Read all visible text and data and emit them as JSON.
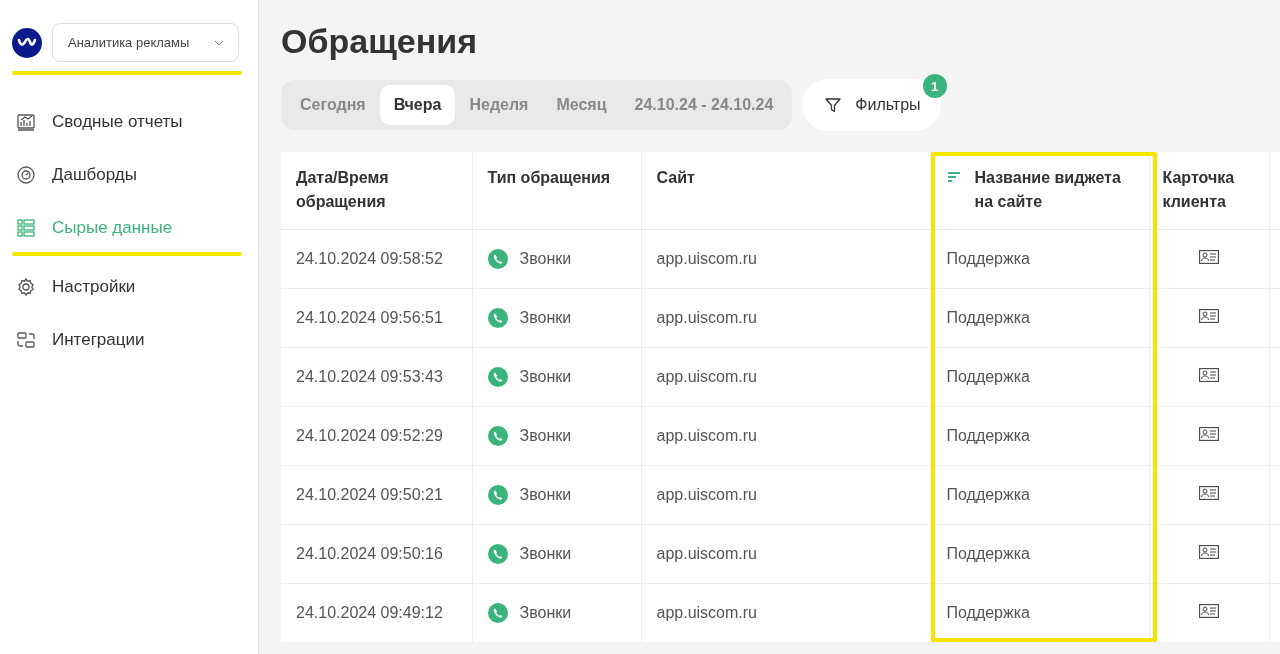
{
  "sidebar": {
    "project": "Аналитика рекламы",
    "items": [
      {
        "label": "Сводные отчеты",
        "selected": false
      },
      {
        "label": "Дашборды",
        "selected": false
      },
      {
        "label": "Сырые данные",
        "selected": true
      },
      {
        "label": "Настройки",
        "selected": false
      },
      {
        "label": "Интеграции",
        "selected": false
      }
    ]
  },
  "page_title": "Обращения",
  "period_tabs": [
    {
      "label": "Сегодня",
      "selected": false
    },
    {
      "label": "Вчера",
      "selected": true
    },
    {
      "label": "Неделя",
      "selected": false
    },
    {
      "label": "Месяц",
      "selected": false
    },
    {
      "label": "24.10.24 - 24.10.24",
      "selected": false
    }
  ],
  "filters": {
    "label": "Фильтры",
    "badge": "1"
  },
  "table": {
    "columns": [
      {
        "label": "Дата/Время обращения",
        "sorted": false
      },
      {
        "label": "Тип обращения",
        "sorted": false
      },
      {
        "label": "Сайт",
        "sorted": false
      },
      {
        "label": "Название виджета на сайте",
        "sorted": true
      },
      {
        "label": "Карточка клиента",
        "sorted": false
      }
    ],
    "rows": [
      {
        "datetime": "24.10.2024 09:58:52",
        "type": "Звонки",
        "kind": "call",
        "site": "app.uiscom.ru",
        "widget": "Поддержка"
      },
      {
        "datetime": "24.10.2024 09:56:51",
        "type": "Звонки",
        "kind": "call",
        "site": "app.uiscom.ru",
        "widget": "Поддержка"
      },
      {
        "datetime": "24.10.2024 09:53:43",
        "type": "Звонки",
        "kind": "call",
        "site": "app.uiscom.ru",
        "widget": "Поддержка"
      },
      {
        "datetime": "24.10.2024 09:52:29",
        "type": "Звонки",
        "kind": "call",
        "site": "app.uiscom.ru",
        "widget": "Поддержка"
      },
      {
        "datetime": "24.10.2024 09:50:21",
        "type": "Звонки",
        "kind": "call",
        "site": "app.uiscom.ru",
        "widget": "Поддержка"
      },
      {
        "datetime": "24.10.2024 09:50:16",
        "type": "Звонки",
        "kind": "call",
        "site": "app.uiscom.ru",
        "widget": "Поддержка"
      },
      {
        "datetime": "24.10.2024 09:49:12",
        "type": "Звонки",
        "kind": "call",
        "site": "app.uiscom.ru",
        "widget": "Поддержка"
      }
    ]
  }
}
